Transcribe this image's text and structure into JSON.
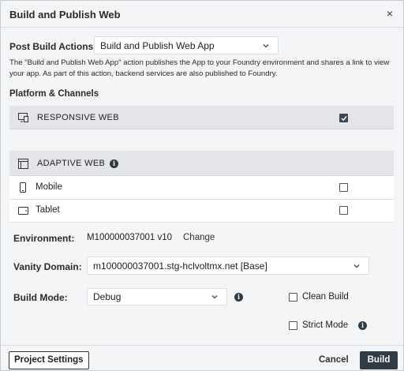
{
  "dialog": {
    "title": "Build and Publish Web",
    "close_glyph": "×"
  },
  "post_build": {
    "label": "Post Build Actions",
    "selected": "Build and Publish Web App",
    "description": "The \"Build and Publish Web App\" action publishes the App to your Foundry environment and shares a link to view your app. As part of this action, backend services are also published to Foundry."
  },
  "platforms": {
    "title": "Platform & Channels",
    "responsive_web": {
      "label": "RESPONSIVE WEB",
      "checked": true
    },
    "adaptive_web": {
      "label": "ADAPTIVE WEB",
      "info_glyph": "i",
      "items": [
        {
          "label": "Mobile",
          "checked": false
        },
        {
          "label": "Tablet",
          "checked": false
        }
      ]
    }
  },
  "environment": {
    "label": "Environment:",
    "value": "M100000037001 v10",
    "change_label": "Change"
  },
  "vanity_domain": {
    "label": "Vanity Domain:",
    "selected": "m100000037001.stg-hclvoltmx.net [Base]"
  },
  "build_mode": {
    "label": "Build Mode:",
    "selected": "Debug",
    "info_glyph": "i",
    "clean_build_label": "Clean Build",
    "clean_build_checked": false,
    "strict_mode_label": "Strict Mode",
    "strict_mode_checked": false,
    "strict_info_glyph": "i"
  },
  "footer": {
    "project_settings_label": "Project Settings",
    "cancel_label": "Cancel",
    "build_label": "Build"
  },
  "colors": {
    "primary": "#2f3b45",
    "band": "#e3e5e8",
    "background": "#f4f5f7"
  }
}
